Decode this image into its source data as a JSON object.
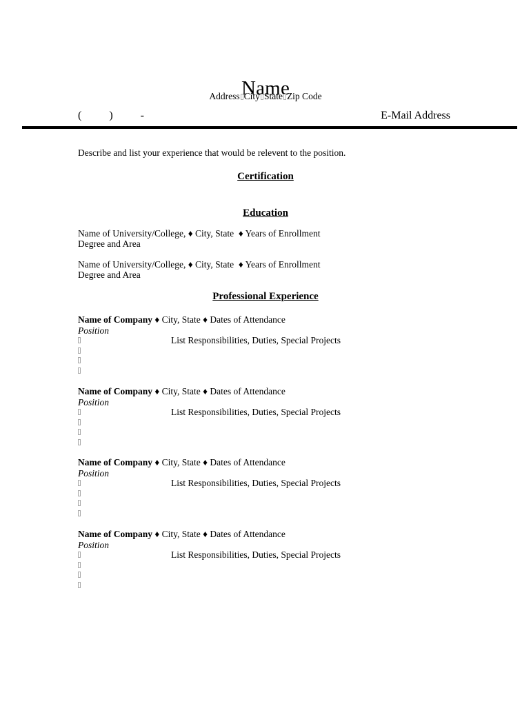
{
  "header": {
    "name": "Name",
    "address_parts": [
      "Address",
      "City",
      "State",
      "Zip Code"
    ],
    "address_separator": "tofu-box-glyph",
    "phone_stub": "(          )          -",
    "email_label": "E-Mail Address"
  },
  "summary": {
    "text": "Describe and list your experience that would be relevent to the position."
  },
  "sections": {
    "certification": "Certification",
    "education": "Education",
    "experience": "Professional Experience"
  },
  "education_entries": [
    {
      "line": "Name of University/College, ♦ City, State  ♦ Years of Enrollment",
      "degree": "Degree and Area"
    },
    {
      "line": "Name of University/College, ♦ City, State  ♦ Years of Enrollment",
      "degree": "Degree and Area"
    }
  ],
  "jobs": [
    {
      "company": "Name of Company",
      "meta": " ♦ City, State ♦ Dates of Attendance",
      "position": "Position",
      "bullets": [
        "List Responsibilities, Duties, Special Projects",
        "",
        "",
        ""
      ]
    },
    {
      "company": "Name of Company",
      "meta": " ♦ City, State ♦ Dates of Attendance",
      "position": "Position",
      "bullets": [
        "List Responsibilities, Duties, Special Projects",
        "",
        "",
        ""
      ]
    },
    {
      "company": "Name of Company",
      "meta": " ♦ City, State ♦ Dates of Attendance",
      "position": "Position",
      "bullets": [
        "List Responsibilities, Duties, Special Projects",
        "",
        "",
        ""
      ]
    },
    {
      "company": "Name of Company",
      "meta": " ♦ City, State ♦ Dates of Attendance",
      "position": "Position",
      "bullets": [
        "List Responsibilities, Duties, Special Projects",
        "",
        "",
        ""
      ]
    }
  ],
  "colors": {
    "text": "#000000",
    "page_background": "#ffffff",
    "rule": "#000000",
    "tofu_border": "#a8a8a8"
  }
}
